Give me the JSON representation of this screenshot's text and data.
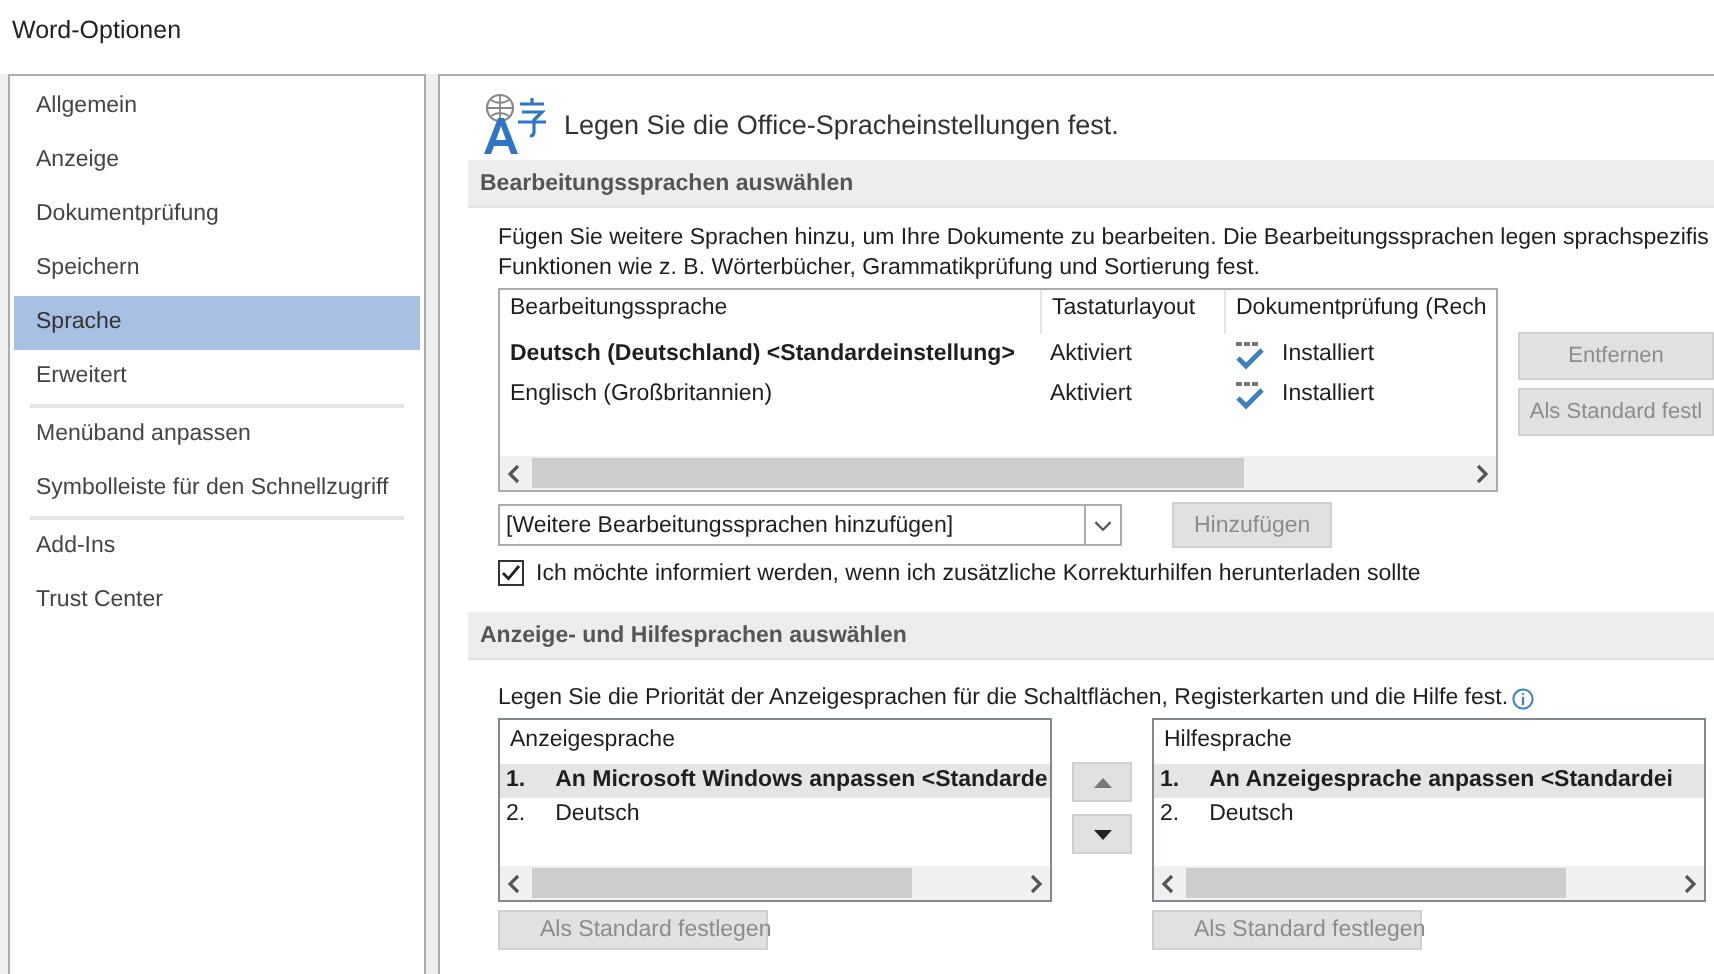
{
  "window": {
    "title": "Word-Optionen"
  },
  "sidebar": {
    "groups": [
      [
        {
          "label": "Allgemein",
          "selected": false
        },
        {
          "label": "Anzeige",
          "selected": false
        },
        {
          "label": "Dokumentprüfung",
          "selected": false
        },
        {
          "label": "Speichern",
          "selected": false
        },
        {
          "label": "Sprache",
          "selected": true
        },
        {
          "label": "Erweitert",
          "selected": false
        }
      ],
      [
        {
          "label": "Menüband anpassen",
          "selected": false
        },
        {
          "label": "Symbolleiste für den Schnellzugriff",
          "selected": false
        }
      ],
      [
        {
          "label": "Add-Ins",
          "selected": false
        },
        {
          "label": "Trust Center",
          "selected": false
        }
      ]
    ]
  },
  "header": {
    "text": "Legen Sie die Office-Spracheinstellungen fest."
  },
  "editing_languages": {
    "title": "Bearbeitungssprachen auswählen",
    "description_lines": [
      "Fügen Sie weitere Sprachen hinzu, um Ihre Dokumente zu bearbeiten. Die Bearbeitungssprachen legen sprachspezifis",
      "Funktionen wie z. B. Wörterbücher, Grammatikprüfung und Sortierung fest."
    ],
    "table": {
      "columns": [
        "Bearbeitungssprache",
        "Tastaturlayout",
        "Dokumentprüfung (Rech"
      ],
      "rows": [
        {
          "cells": [
            "Deutsch (Deutschland) <Standardeinstellung>",
            "Aktiviert",
            "Installiert"
          ],
          "default": true
        },
        {
          "cells": [
            "Englisch (Großbritannien)",
            "Aktiviert",
            "Installiert"
          ],
          "default": false
        }
      ]
    },
    "buttons": [
      {
        "label": "Entfernen",
        "disabled": true
      },
      {
        "label": "Als Standard festl",
        "disabled": true
      }
    ],
    "add_dropdown": {
      "value": "[Weitere Bearbeitungssprachen hinzufügen]"
    },
    "add_button": {
      "label": "Hinzufügen",
      "disabled": true
    },
    "notify_checkbox": {
      "label": "Ich möchte informiert werden, wenn ich zusätzliche Korrekturhilfen herunterladen sollte",
      "checked": true
    }
  },
  "display_languages": {
    "title": "Anzeige- und Hilfesprachen auswählen",
    "description": "Legen Sie die Priorität der Anzeigesprachen für die Schaltflächen, Registerkarten und die Hilfe fest.",
    "lists": [
      {
        "header": "Anzeigesprache",
        "items": [
          {
            "number": "1.",
            "label": "An Microsoft Windows anpassen <Standarde",
            "selected": true,
            "default": true
          },
          {
            "number": "2.",
            "label": "Deutsch",
            "selected": false,
            "default": false
          }
        ],
        "button": {
          "label": "Als Standard festlegen",
          "disabled": true
        }
      },
      {
        "header": "Hilfesprache",
        "items": [
          {
            "number": "1.",
            "label": "An Anzeigesprache anpassen <Standardei",
            "selected": true,
            "default": true
          },
          {
            "number": "2.",
            "label": "Deutsch",
            "selected": false,
            "default": false
          }
        ],
        "button": {
          "label": "Als Standard festlegen",
          "disabled": true
        }
      }
    ]
  }
}
